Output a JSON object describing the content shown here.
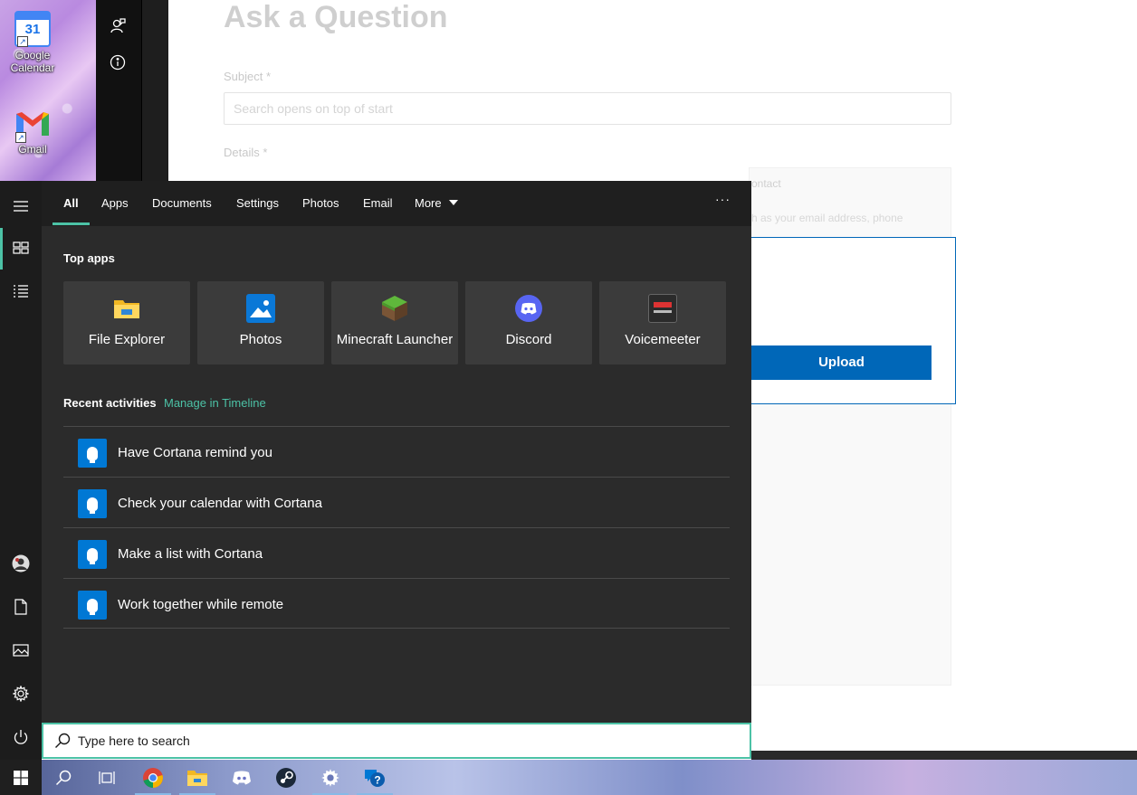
{
  "desktop": {
    "icons": [
      {
        "label": "Google Calendar",
        "icon": "google-calendar-icon",
        "day": "31"
      },
      {
        "label": "Gmail",
        "icon": "gmail-icon"
      }
    ]
  },
  "web_page": {
    "title": "Ask a Question",
    "subject_label": "Subject *",
    "subject_value": "Search opens on top of start",
    "details_label": "Details *",
    "contact_title": "ontact",
    "contact_text": "h as your email address, phone",
    "upload_label": "Upload"
  },
  "start_menu": {
    "tabs": [
      {
        "label": "All",
        "active": true
      },
      {
        "label": "Apps"
      },
      {
        "label": "Documents"
      },
      {
        "label": "Settings"
      },
      {
        "label": "Photos"
      },
      {
        "label": "Email"
      },
      {
        "label": "More"
      }
    ],
    "more_options": "···",
    "top_apps_title": "Top apps",
    "top_apps": [
      {
        "label": "File Explorer",
        "icon": "file-explorer-icon"
      },
      {
        "label": "Photos",
        "icon": "photos-icon"
      },
      {
        "label": "Minecraft Launcher",
        "icon": "minecraft-icon"
      },
      {
        "label": "Discord",
        "icon": "discord-icon"
      },
      {
        "label": "Voicemeeter",
        "icon": "voicemeeter-icon"
      }
    ],
    "recent_title": "Recent activities",
    "manage_timeline": "Manage in Timeline",
    "recent": [
      {
        "label": "Have Cortana remind you"
      },
      {
        "label": "Check your calendar with Cortana"
      },
      {
        "label": "Make a list with Cortana"
      },
      {
        "label": "Work together while remote"
      }
    ]
  },
  "search": {
    "placeholder": "Type here to search"
  },
  "colors": {
    "accent": "#4cc2a6",
    "start_bg": "#2b2b2b",
    "tile_bg": "#3b3b3b",
    "upload_blue": "#0067b8"
  }
}
